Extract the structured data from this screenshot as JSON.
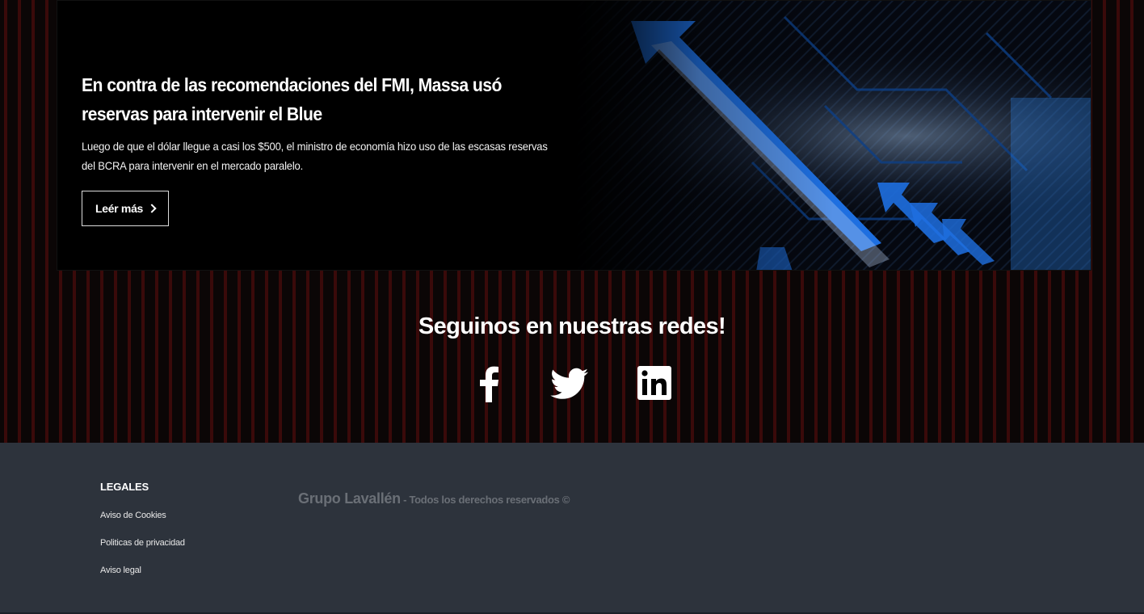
{
  "hero": {
    "title": "En contra de las recomendaciones del FMI, Massa usó reservas para intervenir el Blue",
    "description": "Luego de que el dólar llegue a casi los $500, el ministro de economía hizo uso de las escasas reservas del BCRA para intervenir en el mercado paralelo.",
    "button_label": "Leér más",
    "button_icon": "chevron-right-icon",
    "image": "blue-arrow-circuit-image"
  },
  "social": {
    "title": "Seguinos en nuestras redes!",
    "icons": [
      "facebook-icon",
      "twitter-icon",
      "linkedin-icon"
    ]
  },
  "footer": {
    "legal_heading": "LEGALES",
    "links": [
      "Aviso de Cookies",
      "Politicas de privacidad",
      "Aviso legal"
    ],
    "brand": "Grupo Lavallén",
    "copyright": " - Todos los derechos reservados ©"
  },
  "colors": {
    "pattern_red": "#3a0a0a",
    "footer_bg": "#2d333c",
    "accent_blue": "#1e6fe0"
  }
}
